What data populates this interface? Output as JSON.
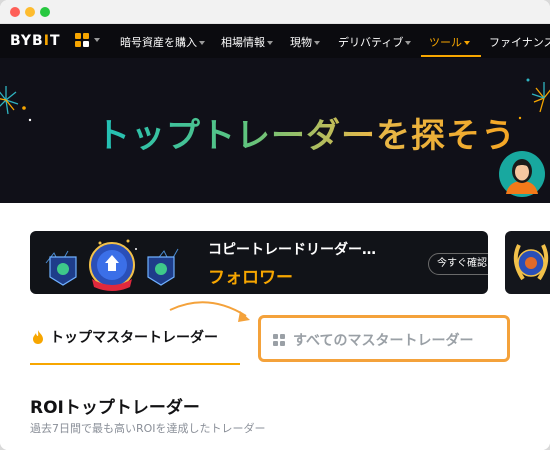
{
  "window": {
    "controls": [
      "close",
      "minimize",
      "zoom"
    ]
  },
  "navbar": {
    "logo_prefix": "BYB",
    "logo_accent": "I",
    "logo_suffix": "T",
    "apps_icon": "grid-apps-icon",
    "items": [
      {
        "label": "暗号資産を購入",
        "caret": true
      },
      {
        "label": "相場情報",
        "caret": true
      },
      {
        "label": "現物",
        "caret": true
      },
      {
        "label": "デリバティブ",
        "caret": true
      },
      {
        "label": "ツール",
        "caret": true,
        "active": true
      },
      {
        "label": "ファイナンス",
        "caret": false
      }
    ],
    "accent_color": "#f7a600"
  },
  "hero": {
    "title": "トップトレーダーを探そう",
    "avatar_icon": "trader-avatar-icon"
  },
  "banner": {
    "title": "コピートレードリーダー…",
    "subtitle": "フォロワー",
    "button_label": "今すぐ確認",
    "button_arrow": "›"
  },
  "tabs": {
    "top_label": "トップマスタートレーダー",
    "top_icon": "fire-icon",
    "all_label": "すべてのマスタートレーダー",
    "all_icon": "grid-icon",
    "highlight_color": "#f4a23b"
  },
  "section": {
    "title": "ROIトップトレーダー",
    "subtitle": "過去7日間で最も高いROIを達成したトレーダー"
  }
}
